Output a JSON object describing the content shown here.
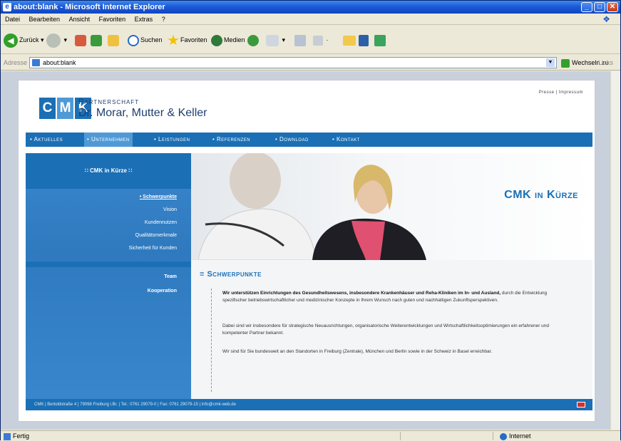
{
  "window": {
    "title": "about:blank - Microsoft Internet Explorer"
  },
  "menu": [
    "Datei",
    "Bearbeiten",
    "Ansicht",
    "Favoriten",
    "Extras",
    "?"
  ],
  "toolbar": {
    "back": "Zurück",
    "search": "Suchen",
    "favorites": "Favoriten",
    "media": "Medien"
  },
  "address": {
    "label": "Adresse",
    "value": "about:blank",
    "go": "Wechseln zu",
    "links": "Links"
  },
  "status": {
    "left": "Fertig",
    "zone": "Internet"
  },
  "site": {
    "toplinks": "Presse | Impressum",
    "logo_letters": [
      "C",
      "M",
      "K"
    ],
    "logo_small": "Partnerschaft",
    "logo_large": "Dr. Morar, Mutter & Keller",
    "nav": [
      "• Aktuelles",
      "• Unternehmen",
      "• Leistungen",
      "• Referenzen",
      "• Download",
      "• Kontakt"
    ],
    "sidebar_head": "∷ CMK in Kürze ∷",
    "sidebar_items": [
      "• Schwerpunkte",
      "Vision",
      "Kundennutzen",
      "Qualitätsmerkmale",
      "Sicherheit für Kunden"
    ],
    "sidebar_items2": [
      "Team",
      "Kooperation"
    ],
    "hero_title": "CMK in Kürze",
    "section_title": "≡ Schwerpunkte",
    "para1_bold": "Wir unterstützen Einrichtungen des Gesundheitswesens, insbesondere Krankenhäuser und Reha-Kliniken im In- und Ausland,",
    "para1_rest": " durch die Entwicklung spezifischer betriebswirtschaftlicher und medizinischer Konzepte in Ihrem Wunsch nach guten und nachhaltigen Zukunftsperspektiven.",
    "para2": "Dabei sind wir insbesondere für strategische Neuausrichtungen, organisatorische Weiterentwicklungen und Wirtschaftlichkeitsoptimierungen ein erfahrener und kompetenter Partner bekannt.",
    "para3": "Wir sind für Sie bundesweit an den Standorten in Freiburg (Zentrale), München und Berlin sowie in der Schweiz in Basel erreichbar.",
    "footer": "CMK | Bertoldstraße 4 | 79098 Freiburg i.Br. | Tel.: 0761 29079-0 | Fax: 0761 29079-15 | info@cmk-web.de"
  }
}
